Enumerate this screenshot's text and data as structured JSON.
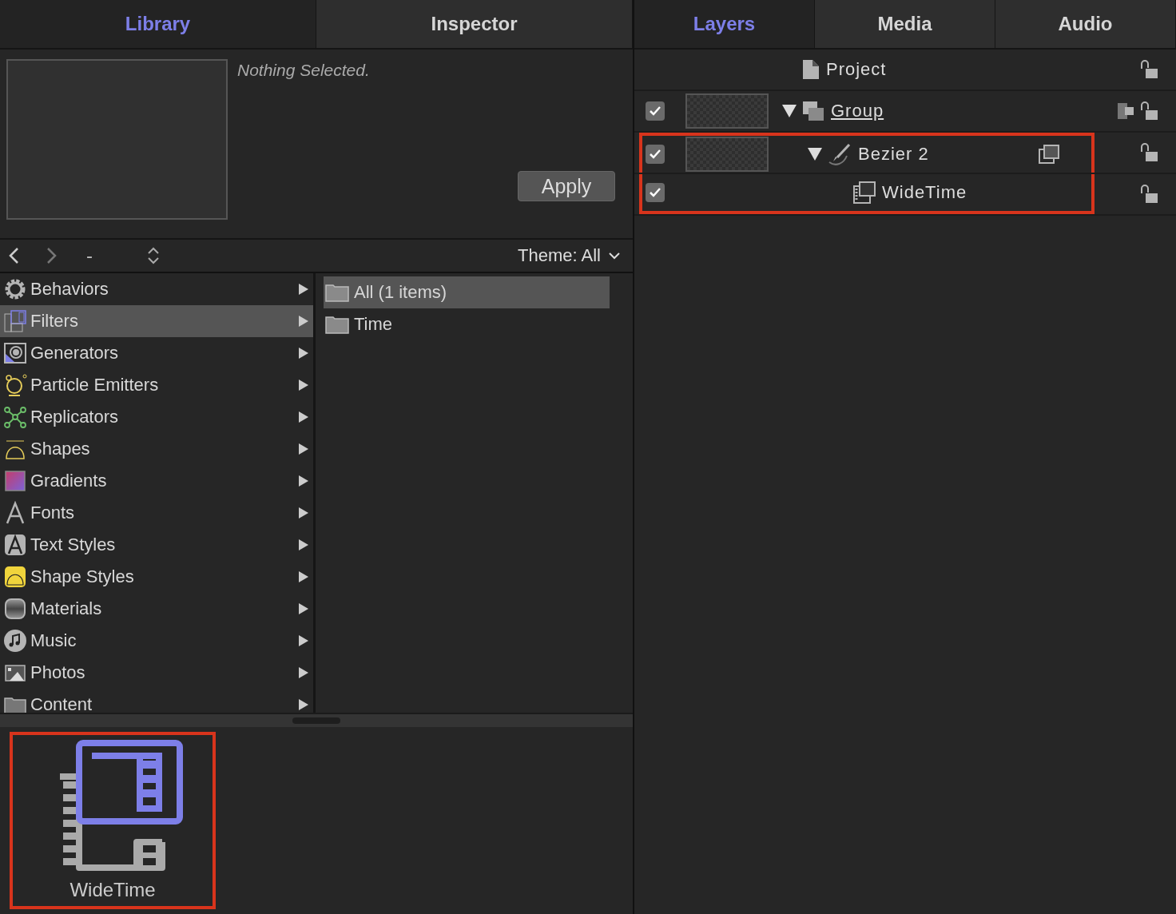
{
  "library_tabs": [
    {
      "label": "Library",
      "selected": true
    },
    {
      "label": "Inspector",
      "selected": false
    }
  ],
  "preview": {
    "status": "Nothing Selected.",
    "apply": "Apply"
  },
  "nav": {
    "minus": "-",
    "theme": "Theme: All"
  },
  "categories": [
    {
      "label": "Behaviors",
      "selected": false
    },
    {
      "label": "Filters",
      "selected": true
    },
    {
      "label": "Generators",
      "selected": false
    },
    {
      "label": "Particle Emitters",
      "selected": false
    },
    {
      "label": "Replicators",
      "selected": false
    },
    {
      "label": "Shapes",
      "selected": false
    },
    {
      "label": "Gradients",
      "selected": false
    },
    {
      "label": "Fonts",
      "selected": false
    },
    {
      "label": "Text Styles",
      "selected": false
    },
    {
      "label": "Shape Styles",
      "selected": false
    },
    {
      "label": "Materials",
      "selected": false
    },
    {
      "label": "Music",
      "selected": false
    },
    {
      "label": "Photos",
      "selected": false
    },
    {
      "label": "Content",
      "selected": false
    }
  ],
  "folders": [
    {
      "label": "All (1 items)",
      "selected": true
    },
    {
      "label": "Time",
      "selected": false
    }
  ],
  "items": [
    {
      "label": "WideTime",
      "highlighted": true
    }
  ],
  "layer_tabs": [
    {
      "label": "Layers",
      "selected": true
    },
    {
      "label": "Media",
      "selected": false
    },
    {
      "label": "Audio",
      "selected": false
    }
  ],
  "layers": [
    {
      "kind": "project",
      "name": "Project",
      "highlighted": false,
      "children": [
        {
          "kind": "group",
          "name": "Group",
          "checked": true,
          "expanded": true,
          "highlighted": false,
          "children": [
            {
              "kind": "shape",
              "name": "Bezier 2",
              "checked": true,
              "expanded": true,
              "highlighted": true,
              "children": [
                {
                  "kind": "filter",
                  "name": "WideTime",
                  "checked": true,
                  "highlighted": true
                }
              ]
            }
          ]
        }
      ]
    }
  ]
}
